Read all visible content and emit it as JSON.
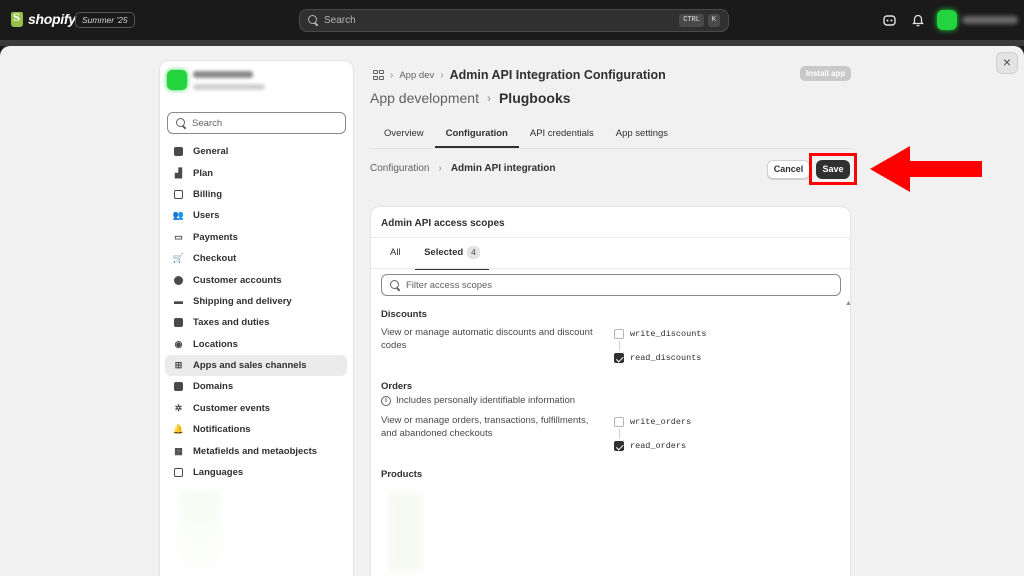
{
  "topbar": {
    "brand": "shopify",
    "edition": "Summer '25",
    "search_placeholder": "Search",
    "shortcut_ctrl": "CTRL",
    "shortcut_k": "K",
    "icons": [
      "help-icon",
      "bell-icon"
    ]
  },
  "sidebar": {
    "search_placeholder": "Search",
    "items": [
      {
        "label": "General",
        "icon": "store-icon"
      },
      {
        "label": "Plan",
        "icon": "plan-icon"
      },
      {
        "label": "Billing",
        "icon": "billing-icon"
      },
      {
        "label": "Users",
        "icon": "users-icon"
      },
      {
        "label": "Payments",
        "icon": "payments-icon"
      },
      {
        "label": "Checkout",
        "icon": "cart-icon"
      },
      {
        "label": "Customer accounts",
        "icon": "person-icon"
      },
      {
        "label": "Shipping and delivery",
        "icon": "truck-icon"
      },
      {
        "label": "Taxes and duties",
        "icon": "taxes-icon"
      },
      {
        "label": "Locations",
        "icon": "location-icon"
      },
      {
        "label": "Apps and sales channels",
        "icon": "apps-icon",
        "active": true
      },
      {
        "label": "Domains",
        "icon": "globe-icon"
      },
      {
        "label": "Customer events",
        "icon": "events-icon"
      },
      {
        "label": "Notifications",
        "icon": "bell-icon"
      },
      {
        "label": "Metafields and metaobjects",
        "icon": "metafields-icon"
      },
      {
        "label": "Languages",
        "icon": "language-icon"
      }
    ]
  },
  "header": {
    "crumb_short": "App dev",
    "title": "Admin API Integration Configuration",
    "install_label": "Install app",
    "parent": "App development",
    "current": "Plugbooks"
  },
  "tabs": [
    "Overview",
    "Configuration",
    "API credentials",
    "App settings"
  ],
  "subheader": {
    "parent": "Configuration",
    "current": "Admin API integration",
    "cancel_label": "Cancel",
    "save_label": "Save"
  },
  "scopes_card": {
    "title": "Admin API access scopes",
    "tab_all": "All",
    "tab_selected": "Selected",
    "selected_count": "4",
    "filter_placeholder": "Filter access scopes",
    "groups": [
      {
        "title": "Discounts",
        "description": "View or manage automatic discounts and discount codes",
        "scopes": [
          {
            "name": "write_discounts",
            "checked": false
          },
          {
            "name": "read_discounts",
            "checked": true
          }
        ]
      },
      {
        "title": "Orders",
        "note": "Includes personally identifiable information",
        "description": "View or manage orders, transactions, fulfillments, and abandoned checkouts",
        "scopes": [
          {
            "name": "write_orders",
            "checked": false
          },
          {
            "name": "read_orders",
            "checked": true
          }
        ]
      },
      {
        "title": "Products"
      }
    ]
  },
  "annotation": {
    "highlight_color": "#ff0000"
  }
}
